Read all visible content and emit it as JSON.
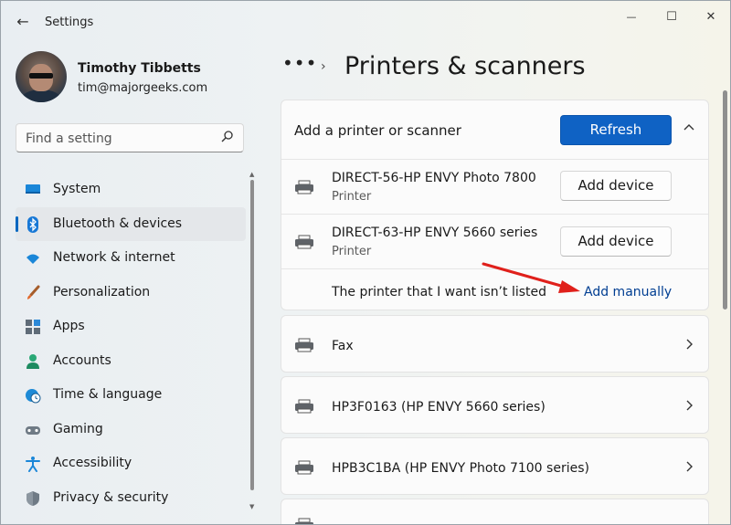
{
  "window": {
    "title": "Settings",
    "back_glyph": "←",
    "controls": {
      "minimize": "—",
      "maximize": "☐",
      "close": "✕"
    }
  },
  "profile": {
    "name": "Timothy Tibbetts",
    "email": "tim@majorgeeks.com"
  },
  "search": {
    "placeholder": "Find a setting"
  },
  "nav": {
    "items": [
      {
        "label": "System",
        "icon": "system-icon"
      },
      {
        "label": "Bluetooth & devices",
        "icon": "bluetooth-icon",
        "active": true
      },
      {
        "label": "Network & internet",
        "icon": "wifi-icon"
      },
      {
        "label": "Personalization",
        "icon": "brush-icon"
      },
      {
        "label": "Apps",
        "icon": "apps-icon"
      },
      {
        "label": "Accounts",
        "icon": "person-icon"
      },
      {
        "label": "Time & language",
        "icon": "clock-globe-icon"
      },
      {
        "label": "Gaming",
        "icon": "gamepad-icon"
      },
      {
        "label": "Accessibility",
        "icon": "accessibility-icon"
      },
      {
        "label": "Privacy & security",
        "icon": "shield-icon"
      }
    ]
  },
  "breadcrumb": {
    "more": "•••",
    "separator": "›"
  },
  "page": {
    "title": "Printers & scanners"
  },
  "add_section": {
    "header": "Add a printer or scanner",
    "refresh_label": "Refresh",
    "collapse_glyph": "˄",
    "devices": [
      {
        "name": "DIRECT-56-HP ENVY Photo 7800",
        "type": "Printer",
        "button": "Add device"
      },
      {
        "name": "DIRECT-63-HP ENVY 5660 series",
        "type": "Printer",
        "button": "Add device"
      }
    ],
    "not_listed_text": "The printer that I want isn’t listed",
    "add_manually_label": "Add manually"
  },
  "installed": [
    {
      "name": "Fax"
    },
    {
      "name": "HP3F0163 (HP ENVY 5660 series)"
    },
    {
      "name": "HPB3C1BA (HP ENVY Photo 7100 series)"
    }
  ],
  "colors": {
    "accent": "#0f62c4",
    "link": "#003e92",
    "annotation_arrow": "#e0201b"
  }
}
